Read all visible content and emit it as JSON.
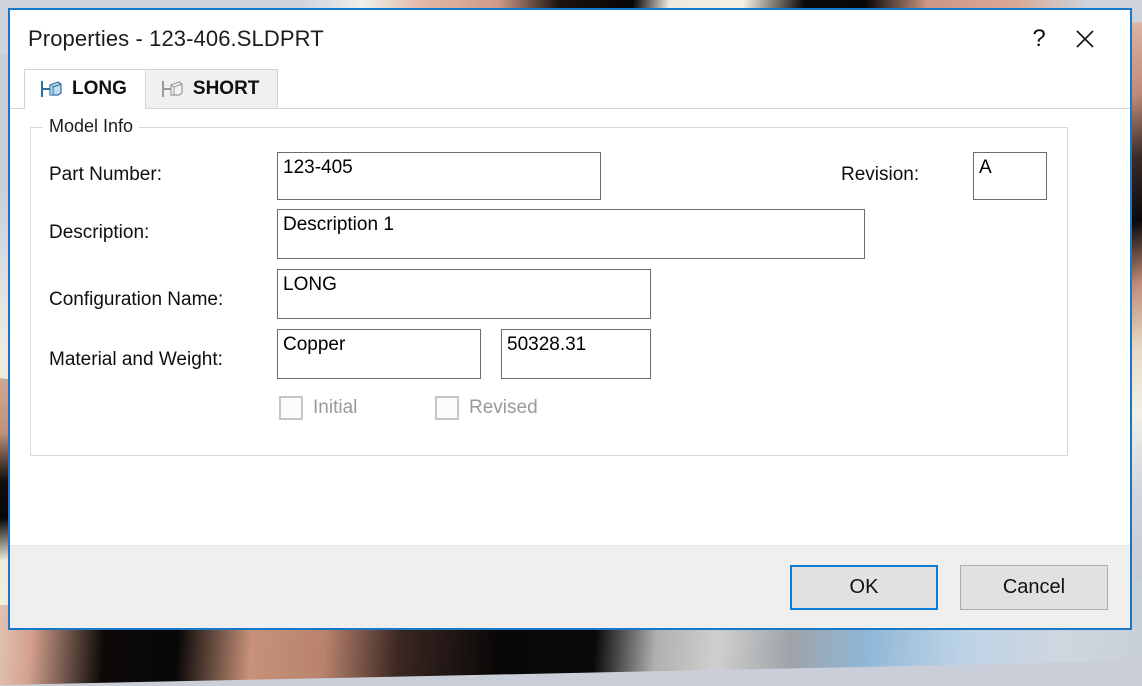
{
  "window": {
    "title": "Properties - 123-406.SLDPRT",
    "help_icon": "question-mark-icon",
    "help_label": "?",
    "close_icon": "close-icon",
    "border_color": "#1878c8"
  },
  "tabs": [
    {
      "label": "LONG",
      "icon": "configuration-icon",
      "active": true
    },
    {
      "label": "SHORT",
      "icon": "configuration-icon",
      "active": false
    }
  ],
  "group": {
    "title": "Model Info",
    "fields": {
      "part_number": {
        "label": "Part Number:",
        "value": "123-405"
      },
      "revision": {
        "label": "Revision:",
        "value": "A"
      },
      "description": {
        "label": "Description:",
        "value": "Description 1"
      },
      "configuration_name": {
        "label": "Configuration Name:",
        "value": "LONG"
      },
      "material_and_weight": {
        "label": "Material and Weight:",
        "material_value": "Copper",
        "weight_value": "50328.31"
      }
    },
    "checkboxes": [
      {
        "label": "Initial",
        "checked": false,
        "disabled": true
      },
      {
        "label": "Revised",
        "checked": false,
        "disabled": true
      }
    ]
  },
  "footer": {
    "ok_label": "OK",
    "cancel_label": "Cancel",
    "default_button_color": "#0c7cd5"
  }
}
